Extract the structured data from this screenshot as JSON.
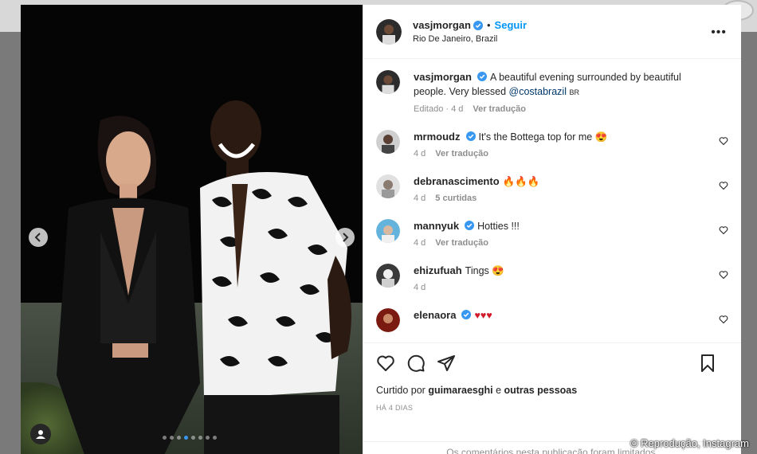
{
  "post": {
    "author": "vasjmorgan",
    "follow_label": "Seguir",
    "location": "Rio De Janeiro, Brazil",
    "more_label": "•••",
    "separator": "•"
  },
  "caption": {
    "username": "vasjmorgan",
    "text": "A beautiful evening surrounded by beautiful people. Very blessed ",
    "mention": "@costabrazil",
    "flag": "BR",
    "edited": "Editado · 4 d",
    "translate": "Ver tradução"
  },
  "comments": [
    {
      "username": "mrmoudz",
      "verified": true,
      "text": "It's the Bottega top for me 😍",
      "time": "4 d",
      "action": "Ver tradução"
    },
    {
      "username": "debranascimento",
      "verified": false,
      "text": "🔥🔥🔥",
      "time": "4 d",
      "action": "5 curtidas"
    },
    {
      "username": "mannyuk",
      "verified": true,
      "text": "Hotties !!!",
      "time": "4 d",
      "action": "Ver tradução"
    },
    {
      "username": "ehizufuah",
      "verified": false,
      "text": "Tings 😍",
      "time": "4 d",
      "action": ""
    },
    {
      "username": "elenaora",
      "verified": true,
      "text": "♥♥♥",
      "time": "",
      "action": ""
    }
  ],
  "likes": {
    "prefix": "Curtido por ",
    "user": "guimaraesghi",
    "middle": " e ",
    "others": "outras pessoas"
  },
  "posted_ago": "HÁ 4 DIAS",
  "limited_notice": "Os comentários nesta publicação foram limitados.",
  "credit": "© Reprodução, Instagram",
  "carousel": {
    "count": 8,
    "active": 4
  },
  "colors": {
    "accent": "#0095f6",
    "verified": "#3897f0",
    "text": "#262626",
    "muted": "#8e8e8e"
  },
  "icons": [
    "chevron-left-icon",
    "chevron-right-icon",
    "user-tag-icon",
    "heart-icon",
    "comment-icon",
    "share-icon",
    "bookmark-icon",
    "verified-icon"
  ]
}
